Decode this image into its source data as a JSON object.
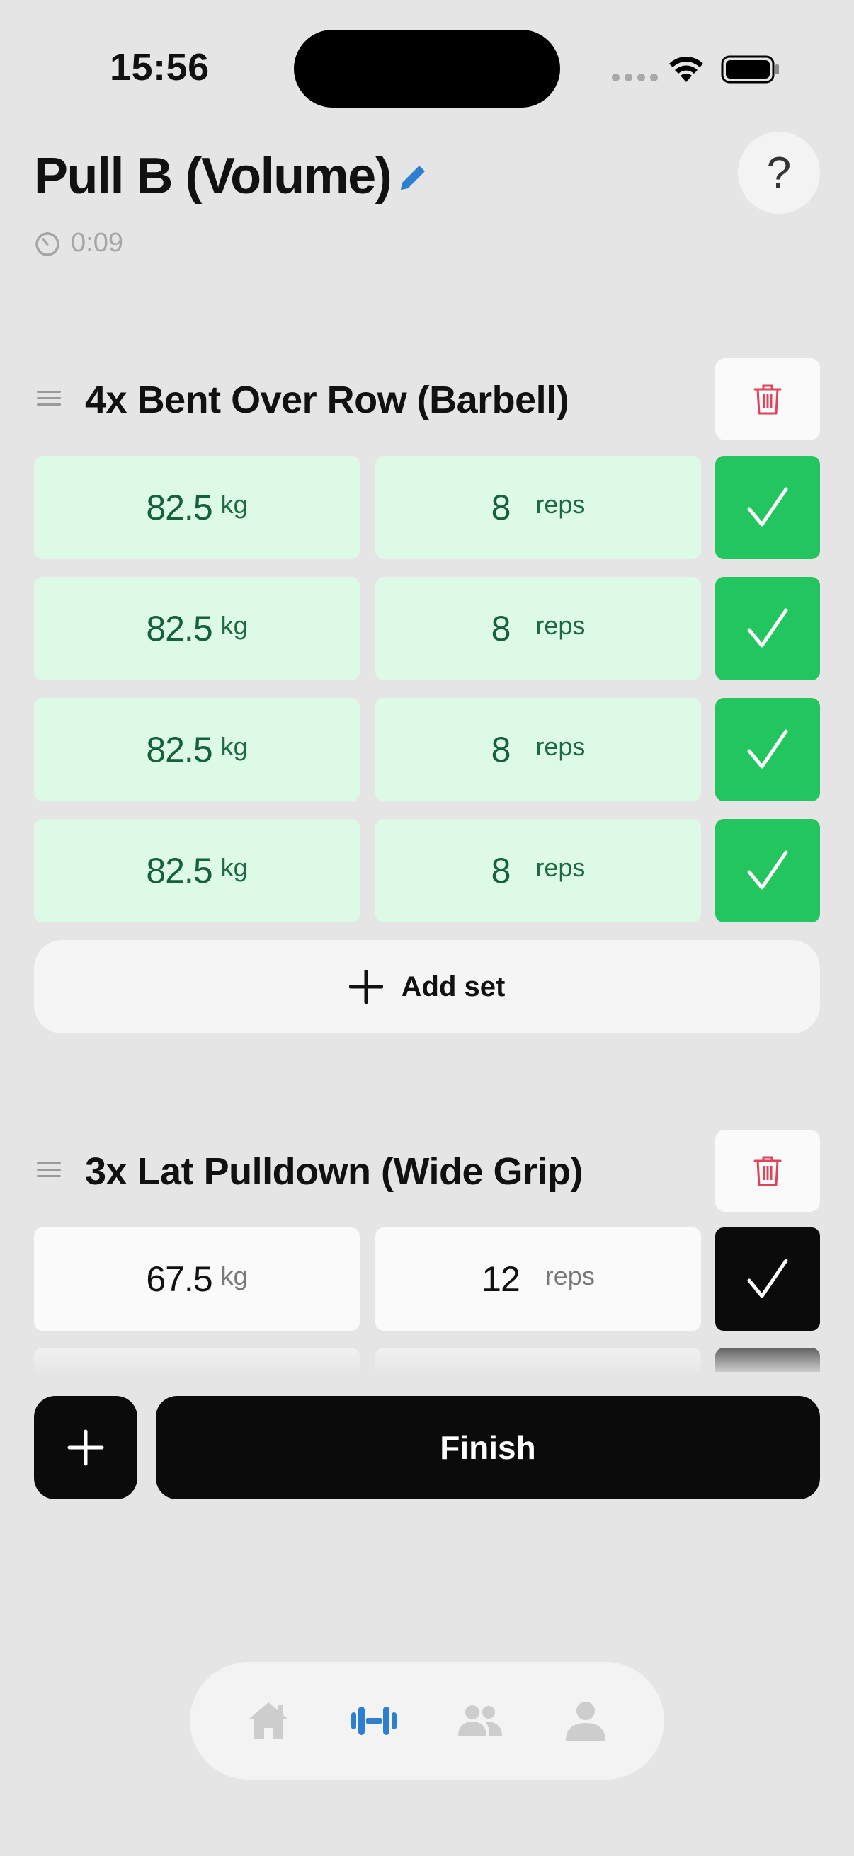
{
  "status_bar": {
    "time": "15:56"
  },
  "header": {
    "title": "Pull B (Volume)",
    "timer": "0:09",
    "help_label": "?"
  },
  "exercises": [
    {
      "title": "4x Bent Over Row (Barbell)",
      "sets": [
        {
          "weight": "82.5",
          "weight_unit": "kg",
          "reps": "8",
          "reps_unit": "reps",
          "completed": true
        },
        {
          "weight": "82.5",
          "weight_unit": "kg",
          "reps": "8",
          "reps_unit": "reps",
          "completed": true
        },
        {
          "weight": "82.5",
          "weight_unit": "kg",
          "reps": "8",
          "reps_unit": "reps",
          "completed": true
        },
        {
          "weight": "82.5",
          "weight_unit": "kg",
          "reps": "8",
          "reps_unit": "reps",
          "completed": true
        }
      ],
      "add_set_label": "Add set"
    },
    {
      "title": "3x Lat Pulldown (Wide Grip)",
      "sets": [
        {
          "weight": "67.5",
          "weight_unit": "kg",
          "reps": "12",
          "reps_unit": "reps",
          "completed": false
        }
      ]
    }
  ],
  "actions": {
    "finish_label": "Finish"
  },
  "tab_bar": {
    "tabs": [
      {
        "icon": "home-icon",
        "active": false
      },
      {
        "icon": "dumbbell-icon",
        "active": true
      },
      {
        "icon": "people-icon",
        "active": false
      },
      {
        "icon": "profile-icon",
        "active": false
      }
    ]
  },
  "colors": {
    "accent": "#2f7fd1",
    "completed_check": "#22c55e",
    "completed_cell": "#dcfae6",
    "delete_icon": "#e0445c",
    "background": "#e5e5e5"
  }
}
